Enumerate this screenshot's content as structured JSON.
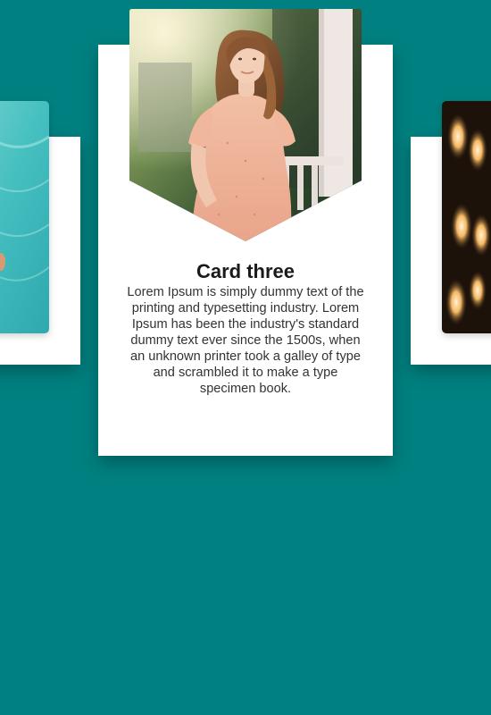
{
  "page": {
    "background_color": "#008080",
    "card_color": "#ffffff"
  },
  "cards": {
    "left": {
      "photo": "ocean-water-photo"
    },
    "main": {
      "title": "Card three",
      "text": "Lorem Ipsum is simply dummy text of the printing and typesetting industry. Lorem Ipsum has been the industry's standard dummy text ever since the 1500s, when an unknown printer took a galley of type and scrambled it to make a type specimen book.",
      "photo": "woman-on-porch-photo"
    },
    "right": {
      "photo": "bokeh-lights-photo"
    }
  }
}
